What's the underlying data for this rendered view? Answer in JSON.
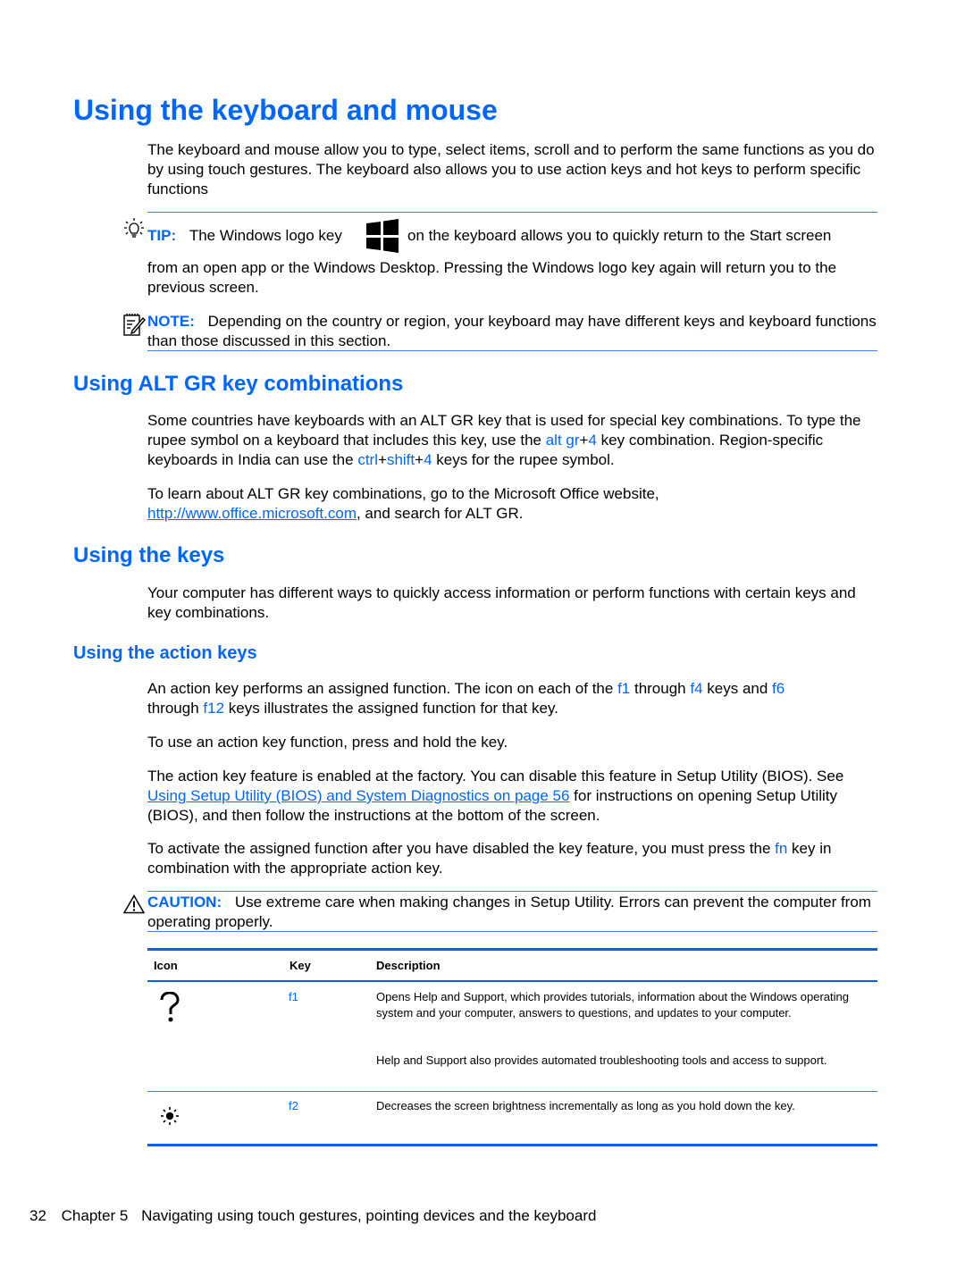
{
  "page": {
    "title": "Using the keyboard and mouse",
    "intro": "The keyboard and mouse allow you to type, select items, scroll and to perform the same functions as you do by using touch gestures. The keyboard also allows you to use action keys and hot keys to perform specific functions",
    "tip": {
      "label": "TIP:",
      "text_before_icon": "The Windows logo key",
      "text_after_icon": "on the keyboard allows you to quickly return to the Start screen",
      "continuation": "from an open app or the Windows Desktop. Pressing the Windows logo key again will return you to the previous screen."
    },
    "note": {
      "label": "NOTE:",
      "text": "Depending on the country or region, your keyboard may have different keys and keyboard functions than those discussed in this section."
    },
    "altgr": {
      "heading": "Using ALT GR key combinations",
      "p1_part1": "Some countries have keyboards with an ALT GR key that is used for special key combinations. To type the rupee symbol on a keyboard that includes this key, use the ",
      "key_altgr": "alt gr",
      "plus1": "+",
      "key_4a": "4",
      "p1_part2": " key combination. Region-specific keyboards in India can use the ",
      "key_ctrl": "ctrl",
      "plus2": "+",
      "key_shift": "shift",
      "plus3": "+",
      "key_4b": "4",
      "p1_part3": " keys for the rupee symbol.",
      "p2_part1": "To learn about ALT GR key combinations, go to the Microsoft Office website,",
      "link": "http://www.office.microsoft.com",
      "p2_part2": ", and search for ALT GR."
    },
    "keys": {
      "heading": "Using the keys",
      "text": "Your computer has different ways to quickly access information or perform functions with certain keys and key combinations."
    },
    "action_keys": {
      "heading": "Using the action keys",
      "p1_a": "An action key performs an assigned function. The icon on each of the ",
      "k_f1": "f1",
      "p1_b": " through ",
      "k_f4": "f4",
      "p1_c": " keys and ",
      "k_f6": "f6",
      "p1_d": " through ",
      "k_f12": "f12",
      "p1_e": " keys illustrates the assigned function for that key.",
      "p2": "To use an action key function, press and hold the key.",
      "p3_a": "The action key feature is enabled at the factory. You can disable this feature in Setup Utility (BIOS). See ",
      "p3_link": "Using Setup Utility (BIOS) and System Diagnostics on page 56",
      "p3_b": " for instructions on opening Setup Utility (BIOS), and then follow the instructions at the bottom of the screen.",
      "p4_a": "To activate the assigned function after you have disabled the key feature, you must press the ",
      "k_fn": "fn",
      "p4_b": " key in combination with the appropriate action key."
    },
    "caution": {
      "label": "CAUTION:",
      "text": "Use extreme care when making changes in Setup Utility. Errors can prevent the computer from operating properly."
    },
    "table": {
      "headers": [
        "Icon",
        "Key",
        "Description"
      ],
      "rows": [
        {
          "icon": "help-question-icon",
          "key": "f1",
          "desc1": "Opens Help and Support, which provides tutorials, information about the Windows operating system and your computer, answers to questions, and updates to your computer.",
          "desc2": "Help and Support also provides automated troubleshooting tools and access to support."
        },
        {
          "icon": "brightness-down-icon",
          "key": "f2",
          "desc1": "Decreases the screen brightness incrementally as long as you hold down the key.",
          "desc2": ""
        }
      ]
    },
    "footer": {
      "page_number": "32",
      "chapter": "Chapter 5",
      "chapter_title": "Navigating using touch gestures, pointing devices and the keyboard"
    }
  },
  "colors": {
    "accent": "#0066ff",
    "rule": "#3a86f0",
    "text": "#000000"
  }
}
